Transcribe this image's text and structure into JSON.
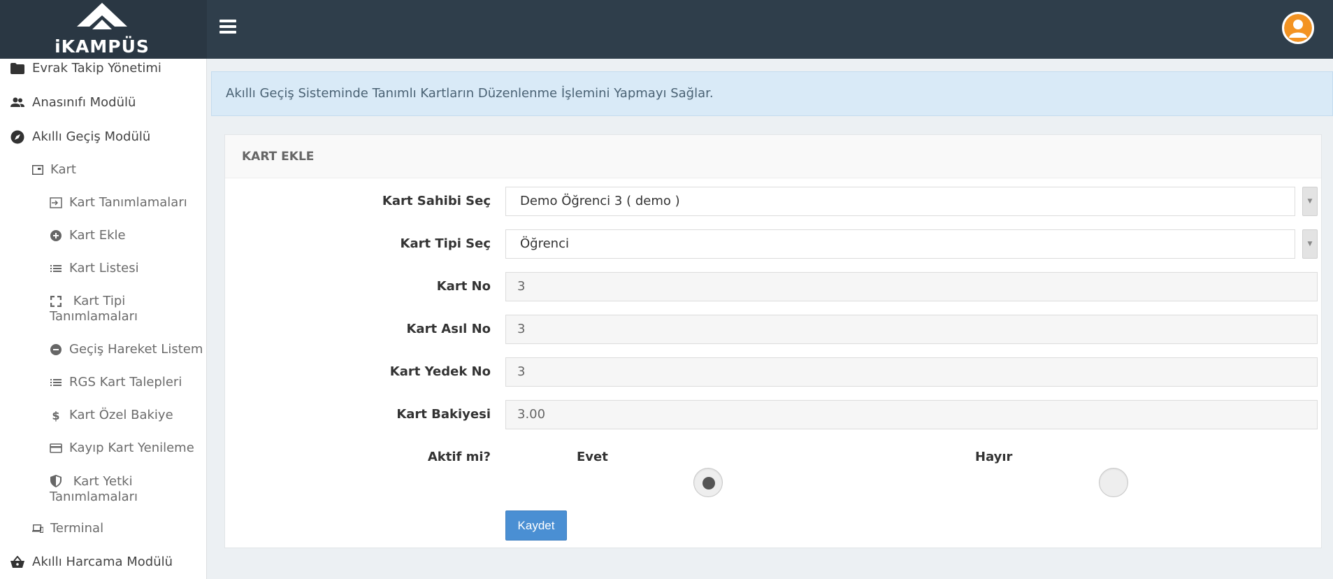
{
  "brand": {
    "logo_text": "iKAMPÜS"
  },
  "header": {
    "menu_icon": "hamburger-icon",
    "avatar_icon": "user-avatar-icon",
    "avatar_color": "#f39322"
  },
  "sidebar": {
    "items": [
      {
        "label": "Evrak Takip Yönetimi",
        "icon": "folder-icon"
      },
      {
        "label": "Anasınıfı Modülü",
        "icon": "users-icon"
      },
      {
        "label": "Akıllı Geçiş Modülü",
        "icon": "compass-icon"
      },
      {
        "label": "Kart",
        "icon": "card-icon"
      },
      {
        "label": "Kart Tanımlamaları",
        "icon": "login-icon"
      },
      {
        "label": "Kart Ekle",
        "icon": "plus-circle-icon"
      },
      {
        "label": "Kart Listesi",
        "icon": "list-icon"
      },
      {
        "label": "Kart Tipi Tanımlamaları",
        "icon": "expand-icon"
      },
      {
        "label": "Geçiş Hareket Listem",
        "icon": "minus-circle-icon"
      },
      {
        "label": "RGS Kart Talepleri",
        "icon": "list-icon"
      },
      {
        "label": "Kart Özel Bakiye",
        "icon": "dollar-icon"
      },
      {
        "label": "Kayıp Kart Yenileme",
        "icon": "credit-card-icon"
      },
      {
        "label": "Kart Yetki Tanımlamaları",
        "icon": "shield-icon"
      },
      {
        "label": "Terminal",
        "icon": "devices-icon"
      },
      {
        "label": "Akıllı Harcama Modülü",
        "icon": "basket-icon"
      }
    ]
  },
  "alert": {
    "text": "Akıllı Geçiş Sisteminde Tanımlı Kartların Düzenlenme İşlemini Yapmayı Sağlar."
  },
  "panel": {
    "title": "KART EKLE",
    "fields": {
      "owner": {
        "label": "Kart Sahibi Seç",
        "value": "Demo Öğrenci 3 ( demo )"
      },
      "type": {
        "label": "Kart Tipi Seç",
        "value": "Öğrenci"
      },
      "card_no": {
        "label": "Kart No",
        "value": "3"
      },
      "main_no": {
        "label": "Kart Asıl No",
        "value": "3"
      },
      "backup_no": {
        "label": "Kart Yedek No",
        "value": "3"
      },
      "balance": {
        "label": "Kart Bakiyesi",
        "value": "3.00"
      }
    },
    "active": {
      "label": "Aktif mi?",
      "yes": "Evet",
      "no": "Hayır",
      "selected": "Evet"
    },
    "save_label": "Kaydet"
  },
  "colors": {
    "topbar": "#2f3e4b",
    "primary_button": "#4a8fd3",
    "alert_bg": "#d9eaf7"
  }
}
